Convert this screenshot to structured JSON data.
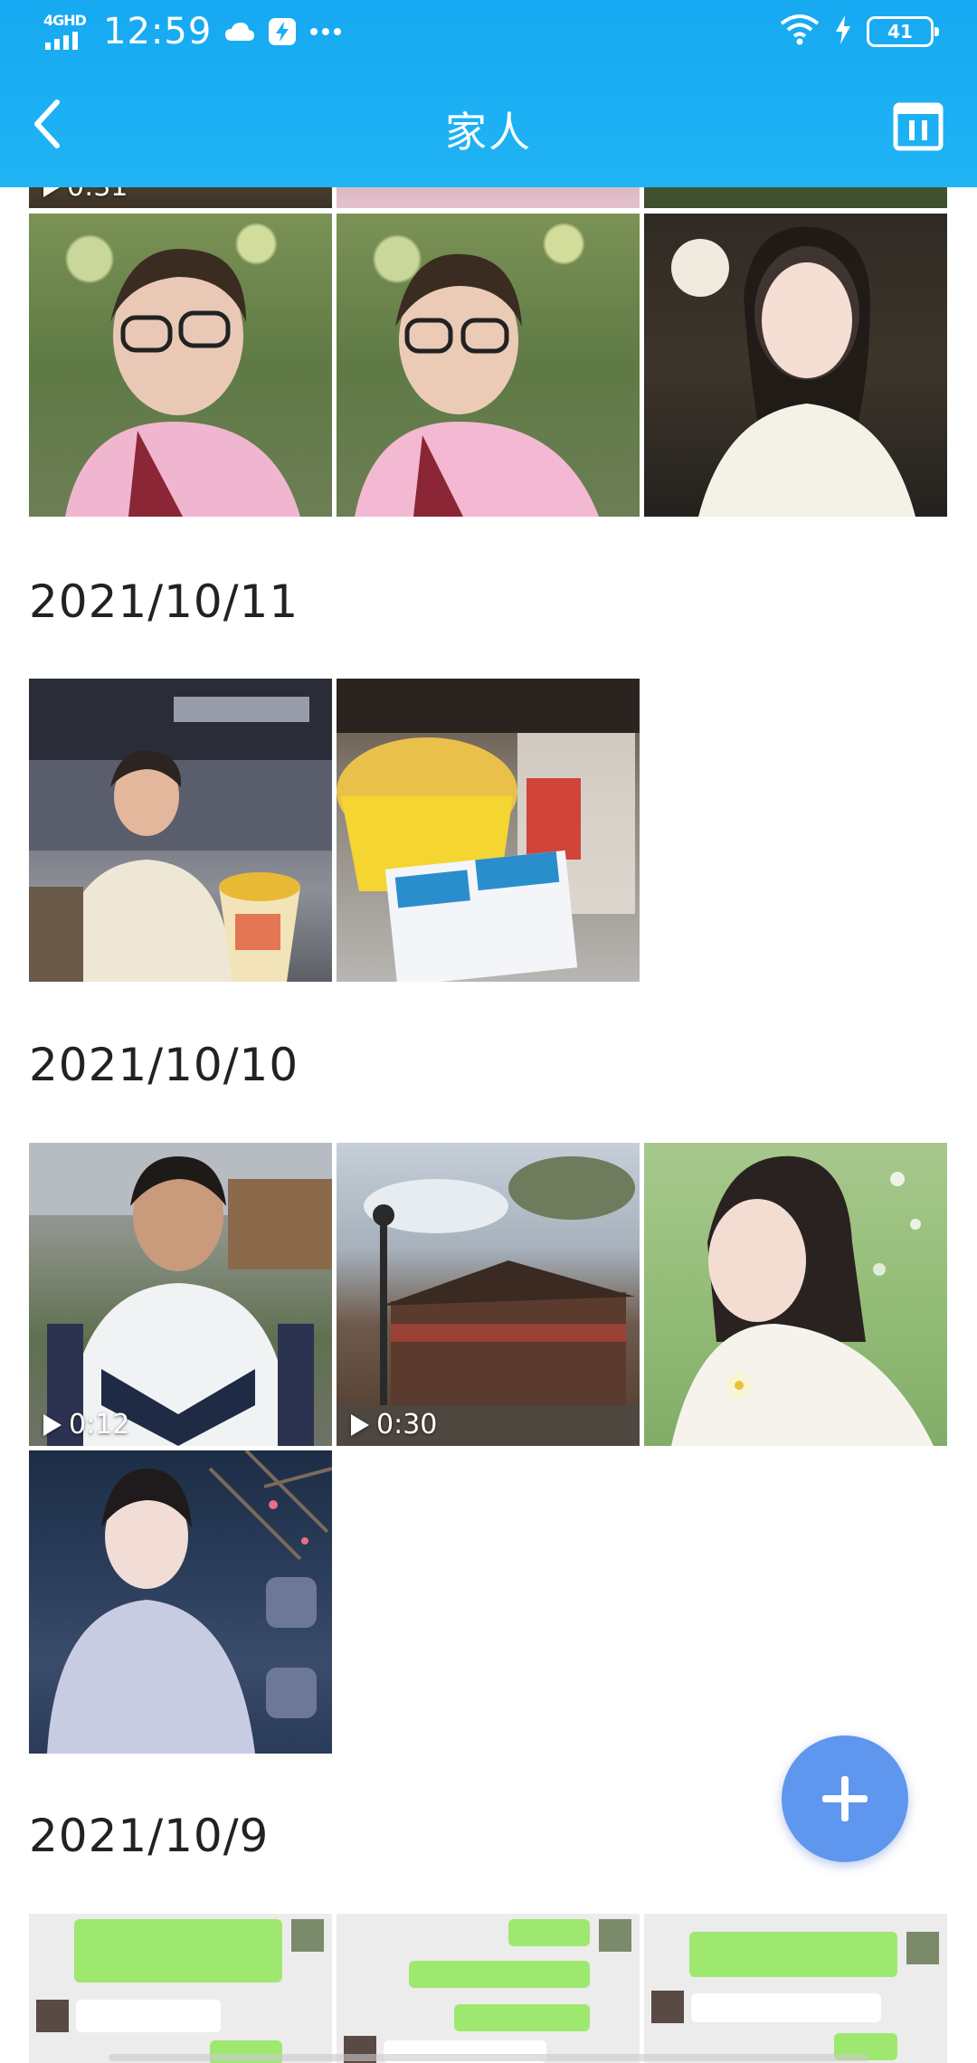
{
  "status_bar": {
    "network": "4GHD",
    "time": "12:59",
    "battery": "41"
  },
  "nav": {
    "title": "家人",
    "back_icon": "chevron-left-icon",
    "calendar_icon": "calendar-icon"
  },
  "colors": {
    "header": "#1aaef4",
    "fab": "#5f96ee",
    "text": "#222222"
  },
  "sections": [
    {
      "date": "",
      "partial": true,
      "items": [
        {
          "type": "video",
          "duration": "0:31"
        },
        {
          "type": "photo"
        },
        {
          "type": "photo"
        },
        {
          "type": "photo"
        },
        {
          "type": "photo"
        },
        {
          "type": "photo"
        }
      ]
    },
    {
      "date": "2021/10/11",
      "items": [
        {
          "type": "photo"
        },
        {
          "type": "photo"
        }
      ]
    },
    {
      "date": "2021/10/10",
      "items": [
        {
          "type": "video",
          "duration": "0:12"
        },
        {
          "type": "video",
          "duration": "0:30"
        },
        {
          "type": "photo"
        },
        {
          "type": "photo"
        }
      ]
    },
    {
      "date": "2021/10/9",
      "items": [
        {
          "type": "photo"
        },
        {
          "type": "photo"
        },
        {
          "type": "photo"
        }
      ]
    }
  ],
  "fab": {
    "icon": "plus-icon"
  }
}
